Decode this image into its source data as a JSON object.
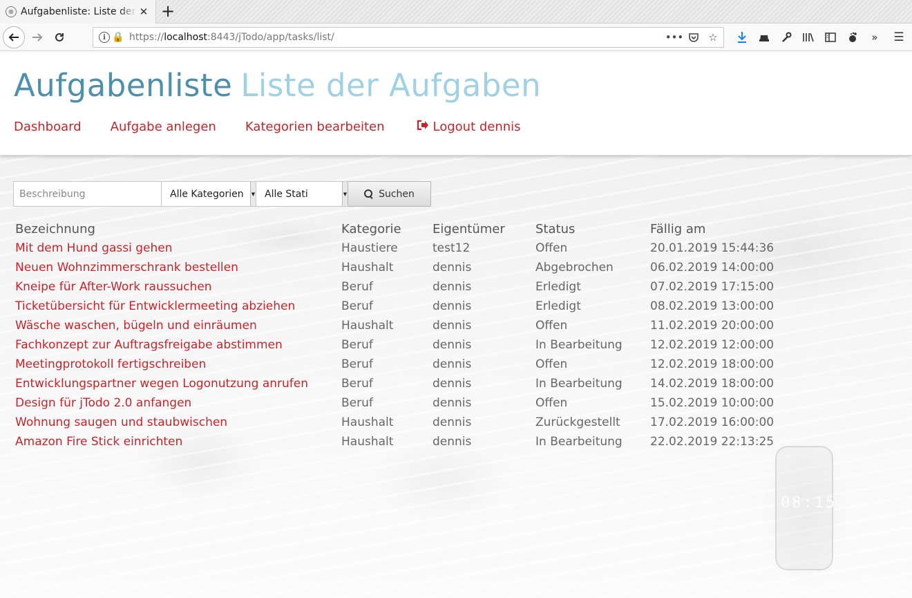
{
  "browser": {
    "tab_title": "Aufgabenliste: Liste der Aufgaben",
    "url_scheme": "https://",
    "url_host": "localhost",
    "url_path": ":8443/jTodo/app/tasks/list/"
  },
  "header": {
    "title": "Aufgabenliste",
    "subtitle": "Liste der Aufgaben",
    "nav": {
      "dashboard": "Dashboard",
      "create_task": "Aufgabe anlegen",
      "edit_categories": "Kategorien bearbeiten",
      "logout": "Logout dennis"
    }
  },
  "search": {
    "placeholder": "Beschreibung",
    "category_selected": "Alle Kategorien",
    "status_selected": "Alle Stati",
    "button_label": "Suchen"
  },
  "table": {
    "headers": {
      "description": "Bezeichnung",
      "category": "Kategorie",
      "owner": "Eigentümer",
      "status": "Status",
      "due": "Fällig am"
    },
    "rows": [
      {
        "description": "Mit dem Hund gassi gehen",
        "category": "Haustiere",
        "owner": "test12",
        "status": "Offen",
        "due": "20.01.2019 15:44:36"
      },
      {
        "description": "Neuen Wohnzimmerschrank bestellen",
        "category": "Haushalt",
        "owner": "dennis",
        "status": "Abgebrochen",
        "due": "06.02.2019 14:00:00"
      },
      {
        "description": "Kneipe für After-Work raussuchen",
        "category": "Beruf",
        "owner": "dennis",
        "status": "Erledigt",
        "due": "07.02.2019 17:15:00"
      },
      {
        "description": "Ticketübersicht für Entwicklermeeting abziehen",
        "category": "Beruf",
        "owner": "dennis",
        "status": "Erledigt",
        "due": "08.02.2019 13:00:00"
      },
      {
        "description": "Wäsche waschen, bügeln und einräumen",
        "category": "Haushalt",
        "owner": "dennis",
        "status": "Offen",
        "due": "11.02.2019 20:00:00"
      },
      {
        "description": "Fachkonzept zur Auftragsfreigabe abstimmen",
        "category": "Beruf",
        "owner": "dennis",
        "status": "In Bearbeitung",
        "due": "12.02.2019 12:00:00"
      },
      {
        "description": "Meetingprotokoll fertigschreiben",
        "category": "Beruf",
        "owner": "dennis",
        "status": "Offen",
        "due": "12.02.2019 18:00:00"
      },
      {
        "description": "Entwicklungspartner wegen Logonutzung anrufen",
        "category": "Beruf",
        "owner": "dennis",
        "status": "In Bearbeitung",
        "due": "14.02.2019 18:00:00"
      },
      {
        "description": "Design für jTodo 2.0 anfangen",
        "category": "Beruf",
        "owner": "dennis",
        "status": "Offen",
        "due": "15.02.2019 10:00:00"
      },
      {
        "description": "Wohnung saugen und staubwischen",
        "category": "Haushalt",
        "owner": "dennis",
        "status": "Zurückgestellt",
        "due": "17.02.2019 16:00:00"
      },
      {
        "description": "Amazon Fire Stick einrichten",
        "category": "Haushalt",
        "owner": "dennis",
        "status": "In Bearbeitung",
        "due": "22.02.2019 22:13:25"
      }
    ]
  },
  "background_clock": "08:15",
  "colors": {
    "title": "#4e8fab",
    "subtitle": "#9fd0e3",
    "link": "#c0272d",
    "text": "#666666"
  }
}
